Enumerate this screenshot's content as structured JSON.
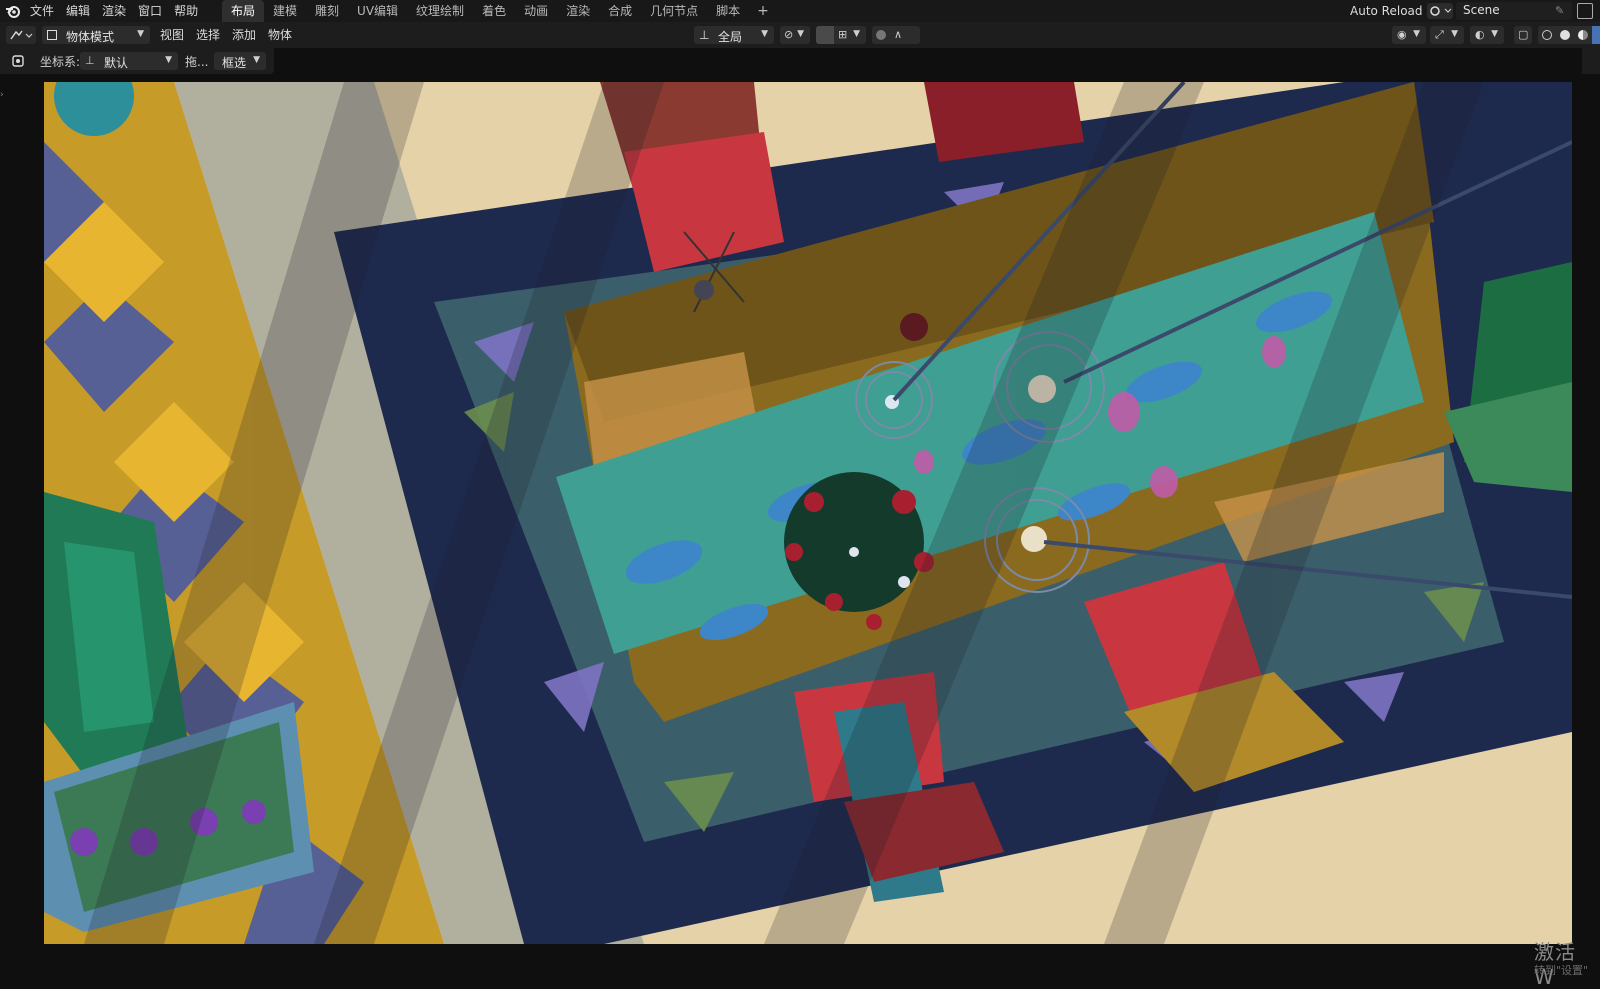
{
  "app": {
    "name": "Blender"
  },
  "topbar": {
    "menus": [
      "文件",
      "编辑",
      "渲染",
      "窗口",
      "帮助"
    ],
    "workspaces": [
      "布局",
      "建模",
      "雕刻",
      "UV编辑",
      "纹理绘制",
      "着色",
      "动画",
      "渲染",
      "合成",
      "几何节点",
      "脚本"
    ],
    "active_workspace": "布局",
    "add_workspace": "+",
    "auto_reload": "Auto Reload",
    "scene_name": "Scene"
  },
  "viewport_header": {
    "mode": "物体模式",
    "menus": [
      "视图",
      "选择",
      "添加",
      "物体"
    ],
    "orientation": "全局"
  },
  "tool_settings": {
    "coord_label": "坐标系:",
    "coord_value": "默认",
    "drag_label": "拖...",
    "select_mode": "框选"
  },
  "icons": {
    "logo": "blender-logo-icon",
    "scene": "scene-icon",
    "pin": "pin-icon",
    "transform": "transform-icon",
    "snap": "magnet-icon",
    "proportional": "proportional-edit-icon",
    "visibility": "eye-icon",
    "gizmo": "gizmo-icon",
    "overlay": "overlay-icon",
    "xray": "xray-icon",
    "shading": [
      "wireframe-icon",
      "solid-icon",
      "material-icon",
      "rendered-icon"
    ]
  },
  "colors": {
    "topbar_bg": "#181818",
    "header_bg": "#1d1d1d",
    "active_tab_bg": "#2f2f2f",
    "table_wood": "#8a6a1f",
    "runner_teal": "#3f9f92",
    "chair_red": "#c8373f",
    "floor_cream": "#e6d2a8",
    "rug_navy": "#1e2a4d"
  },
  "watermark": {
    "text": "激活 W",
    "sub_text": "转到\"设置\""
  }
}
